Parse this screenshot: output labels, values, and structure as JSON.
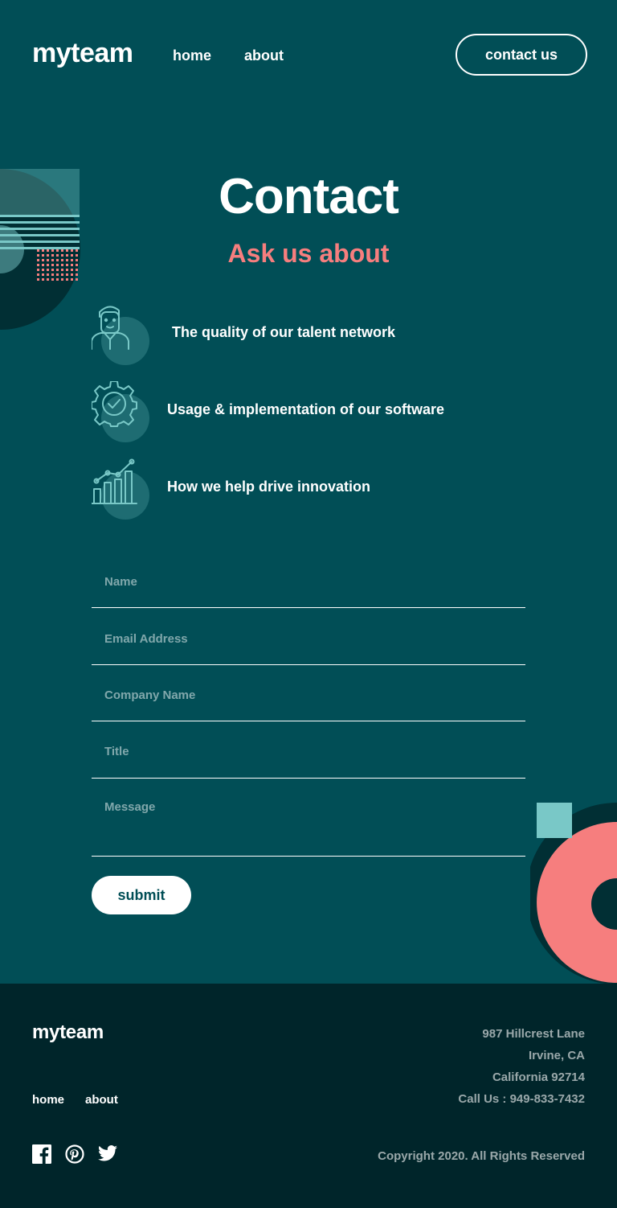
{
  "colors": {
    "background": "#014e56",
    "footer_bg": "#00252a",
    "accent_coral": "#f67e7e",
    "accent_teal": "#79c8c7",
    "dark_teal": "#012f34",
    "white": "#ffffff"
  },
  "header": {
    "logo": "myteam",
    "nav": [
      {
        "label": "home"
      },
      {
        "label": "about"
      }
    ],
    "cta_label": "contact us"
  },
  "main": {
    "title": "Contact",
    "subtitle": "Ask us about",
    "features": [
      {
        "icon": "person-icon",
        "text": "The quality of our talent network"
      },
      {
        "icon": "gear-check-icon",
        "text": "Usage & implementation of our software"
      },
      {
        "icon": "chart-icon",
        "text": "How we help drive innovation"
      }
    ]
  },
  "form": {
    "name_placeholder": "Name",
    "email_placeholder": "Email Address",
    "company_placeholder": "Company Name",
    "title_placeholder": "Title",
    "message_placeholder": "Message",
    "submit_label": "submit"
  },
  "footer": {
    "logo": "myteam",
    "nav": [
      {
        "label": "home"
      },
      {
        "label": "about"
      }
    ],
    "address": [
      "987 Hillcrest Lane",
      "Irvine, CA",
      "California 92714",
      "Call Us : 949-833-7432"
    ],
    "social": [
      "facebook-icon",
      "pinterest-icon",
      "twitter-icon"
    ],
    "copyright": "Copyright 2020. All Rights Reserved"
  }
}
